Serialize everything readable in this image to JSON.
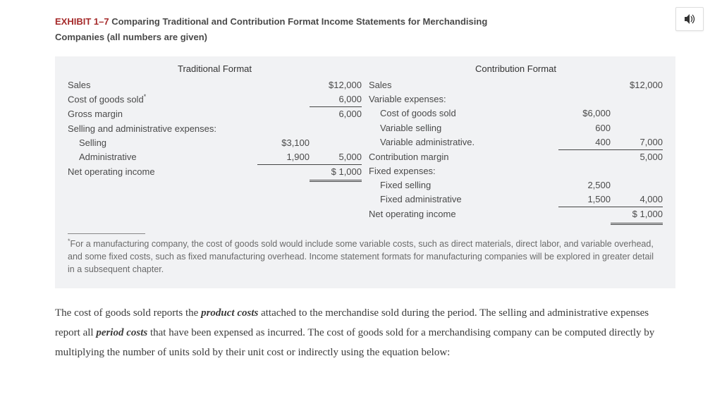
{
  "speaker_icon": "volume-icon",
  "header": {
    "exhibit_label": "EXHIBIT 1–7",
    "title_rest": "Comparing Traditional and Contribution Format Income Statements for Merchandising",
    "title_line2": "Companies (all numbers are given)"
  },
  "traditional": {
    "heading": "Traditional Format",
    "rows": {
      "sales_lbl": "Sales",
      "sales_amt": "$12,000",
      "cogs_lbl": "Cost of goods sold",
      "cogs_amt": "6,000",
      "gross_lbl": "Gross margin",
      "gross_amt": "6,000",
      "sae_lbl": "Selling and administrative expenses:",
      "selling_lbl": "Selling",
      "selling_amt": "$3,100",
      "admin_lbl": "Administrative",
      "admin_amt": "1,900",
      "sae_total": "5,000",
      "noi_lbl": "Net operating income",
      "noi_amt": "$ 1,000"
    }
  },
  "contribution": {
    "heading": "Contribution Format",
    "rows": {
      "sales_lbl": "Sales",
      "sales_amt": "$12,000",
      "varexp_lbl": "Variable expenses:",
      "vcogs_lbl": "Cost of goods sold",
      "vcogs_amt": "$6,000",
      "vsell_lbl": "Variable selling",
      "vsell_amt": "600",
      "vadmin_lbl": "Variable administrative.",
      "vadmin_amt": "400",
      "var_total": "7,000",
      "cm_lbl": "Contribution margin",
      "cm_amt": "5,000",
      "fixexp_lbl": "Fixed expenses:",
      "fsell_lbl": "Fixed selling",
      "fsell_amt": "2,500",
      "fadmin_lbl": "Fixed administrative",
      "fadmin_amt": "1,500",
      "fix_total": "4,000",
      "noi_lbl": "Net operating income",
      "noi_amt": "$ 1,000"
    }
  },
  "footnote": {
    "marker": "*",
    "text": "For a manufacturing company, the cost of goods sold would include some variable costs, such as direct materials, direct labor, and variable overhead, and some fixed costs, such as fixed manufacturing overhead. Income statement formats for manufacturing companies will be explored in greater detail in a subsequent chapter."
  },
  "paragraph": {
    "p1a": "The cost of goods sold reports the ",
    "p1b": "product costs",
    "p1c": " attached to the merchandise sold during the period. The selling and administrative expenses report all ",
    "p1d": "period costs",
    "p1e": " that have been expensed as incurred. The cost of goods sold for a merchandising company can be computed directly by multiplying the number of units sold by their unit cost or indirectly using the equation below:"
  },
  "chart_data": {
    "type": "table",
    "title": "Comparing Traditional and Contribution Format Income Statements for Merchandising Companies",
    "traditional_format": {
      "Sales": 12000,
      "Cost of goods sold": 6000,
      "Gross margin": 6000,
      "Selling and administrative expenses": {
        "Selling": 3100,
        "Administrative": 1900,
        "Total": 5000
      },
      "Net operating income": 1000
    },
    "contribution_format": {
      "Sales": 12000,
      "Variable expenses": {
        "Cost of goods sold": 6000,
        "Variable selling": 600,
        "Variable administrative": 400,
        "Total": 7000
      },
      "Contribution margin": 5000,
      "Fixed expenses": {
        "Fixed selling": 2500,
        "Fixed administrative": 1500,
        "Total": 4000
      },
      "Net operating income": 1000
    }
  }
}
